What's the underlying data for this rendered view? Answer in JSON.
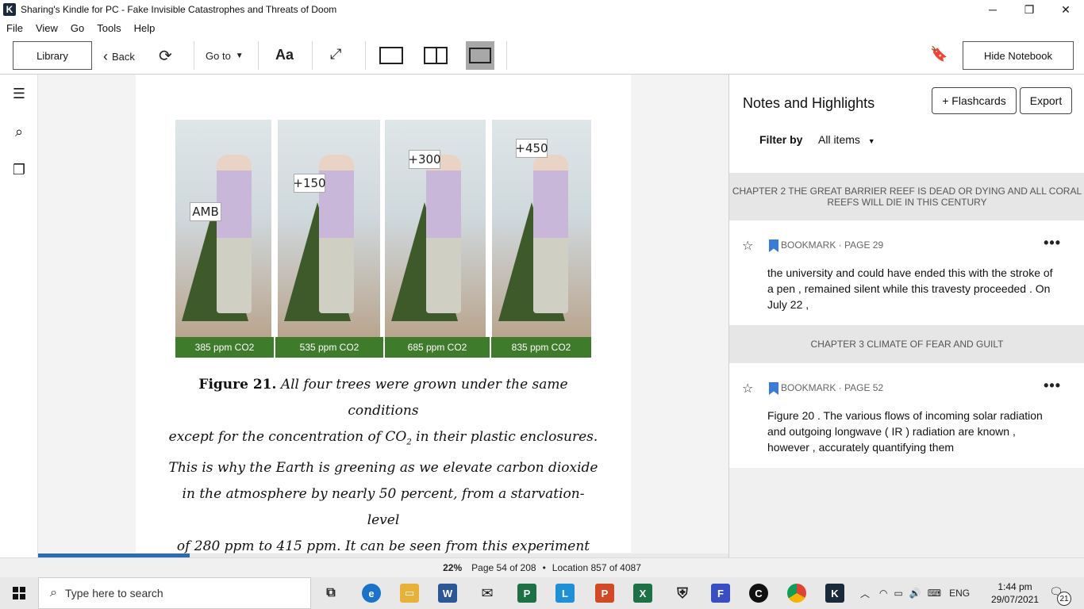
{
  "window": {
    "title": "Sharing's Kindle for PC - Fake Invisible Catastrophes and Threats of Doom",
    "app_icon": "kindle-icon",
    "controls": {
      "minimize": "─",
      "restore": "❐",
      "close": "✕"
    }
  },
  "menu": [
    "File",
    "View",
    "Go",
    "Tools",
    "Help"
  ],
  "toolbar": {
    "library": "Library",
    "back": "Back",
    "goto": "Go to",
    "font": "Aa",
    "hide_notebook": "Hide Notebook"
  },
  "book": {
    "figure": {
      "labels": [
        "385 ppm CO2",
        "535 ppm CO2",
        "685 ppm CO2",
        "835 ppm CO2"
      ],
      "signs": [
        "AMB",
        "+150",
        "+300",
        "+450"
      ]
    },
    "caption": {
      "lead": "Figure 21.",
      "line1": "All four trees were grown under the same conditions",
      "line2a": "except for the concentration of CO",
      "line2sub": "2",
      "line2b": " in their plastic enclosures.",
      "line3": "This is why the Earth is greening as we elevate carbon dioxide",
      "line4": "in the atmosphere by nearly 50 percent, from a starvation-level",
      "line5": "of 280 ppm to 415 ppm. It can be seen from this experiment"
    }
  },
  "progress": {
    "percent": 22
  },
  "notebook": {
    "title": "Notes and Highlights",
    "flashcards": "+ Flashcards",
    "export": "Export",
    "filter_label": "Filter by",
    "filter_value": "All items",
    "chapters": [
      {
        "title": "CHAPTER 2 THE GREAT BARRIER REEF IS DEAD OR DYING AND ALL CORAL REEFS WILL DIE IN THIS CENTURY"
      },
      {
        "title": "CHAPTER 3 CLIMATE OF FEAR AND GUILT"
      }
    ],
    "notes": [
      {
        "label": "BOOKMARK · PAGE 29",
        "text": "the university and could have ended this with the stroke of a pen , remained silent while this travesty proceeded . On July 22 ,"
      },
      {
        "label": "BOOKMARK · PAGE 52",
        "text": "Figure 20 . The various flows of incoming solar radiation and outgoing longwave ( IR ) radiation are known , however , accurately quantifying them"
      }
    ]
  },
  "status": {
    "percent": "22%",
    "page": "Page 54 of 208",
    "location": "Location 857 of 4087"
  },
  "taskbar": {
    "search_placeholder": "Type here to search",
    "language": "ENG",
    "time": "1:44 pm",
    "date": "29/07/2021",
    "notifications": "21"
  }
}
